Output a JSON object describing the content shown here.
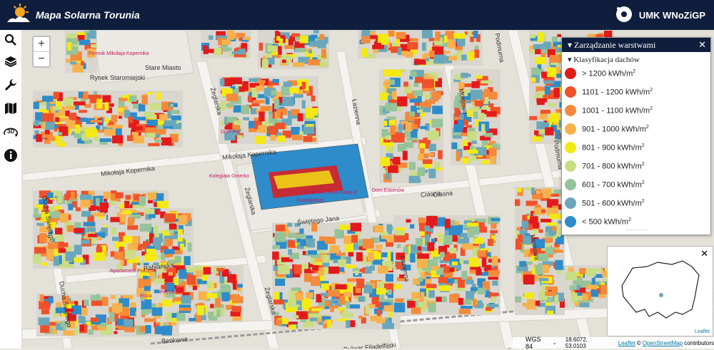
{
  "header": {
    "title": "Mapa Solarna Torunia",
    "partner_logo_text": "UMK WNoZiGP"
  },
  "sidebar": {
    "tools": [
      {
        "name": "search-icon"
      },
      {
        "name": "layers-icon"
      },
      {
        "name": "wrench-icon"
      },
      {
        "name": "map-icon"
      },
      {
        "name": "3d-icon",
        "label": "3D"
      },
      {
        "name": "info-icon"
      }
    ]
  },
  "map": {
    "zoom_in": "+",
    "zoom_out": "−",
    "streets": [
      "Mikołaja Kopernika",
      "Mikołaja Kopernika",
      "Ciasna",
      "Rabiańska",
      "Świętego Jana",
      "Żeglarska",
      "Żeglarska",
      "Żeglarska",
      "Łazienna",
      "Łazienna",
      "Mostowa",
      "Mostowa",
      "Podmurna",
      "Podmurna",
      "Ducha Świętego",
      "Ducha Świętego",
      "Bankowa",
      "Bulwar Filadelfijski",
      "Bulwar Filadelfijski",
      "Rynek Staromiejski",
      "Stare Miasto",
      "Ciasna"
    ],
    "pois": [
      "Pomnik Mikołaja Kopernika",
      "Kolegiata Gmerko",
      "Dom Eskenów",
      "Apartament Pokojski",
      "Piernik",
      "Róża",
      "Kościół św. Jana Pawła II",
      "Ewangelisty",
      "Dom Po"
    ]
  },
  "layer_panel": {
    "title": "Zarządzanie warstwami",
    "group": "Klasyfikacja dachów",
    "legend": [
      {
        "label": "> 1200 kWh/m",
        "sup": "2",
        "color": "#e31a1c"
      },
      {
        "label": "1101 - 1200 kWh/m",
        "sup": "2",
        "color": "#f0512b"
      },
      {
        "label": "1001 - 1100 kWh/m",
        "sup": "2",
        "color": "#f58a3a"
      },
      {
        "label": "901 - 1000 kWh/m",
        "sup": "2",
        "color": "#f7b24e"
      },
      {
        "label": "801 - 900 kWh/m",
        "sup": "2",
        "color": "#f4ea12"
      },
      {
        "label": "701 - 800 kWh/m",
        "sup": "2",
        "color": "#c9dd85"
      },
      {
        "label": "601 - 700 kWh/m",
        "sup": "2",
        "color": "#96c39a"
      },
      {
        "label": "501 - 600 kWh/m",
        "sup": "2",
        "color": "#6aa7bb"
      },
      {
        "label": "< 500 kWh/m",
        "sup": "2",
        "color": "#2d8cc9"
      }
    ]
  },
  "minimap": {
    "attribution": "Leaflet"
  },
  "status": {
    "crs": "WGS 84",
    "coords": "18.6072, 53.0103",
    "attribution_leaflet": "Leaflet",
    "attribution_sep": "©",
    "attribution_osm": "OpenStreetMap",
    "attribution_tail": "contributors"
  },
  "colors": {
    "header_bg": "#0f1e3d",
    "sun": "#f5a623"
  }
}
